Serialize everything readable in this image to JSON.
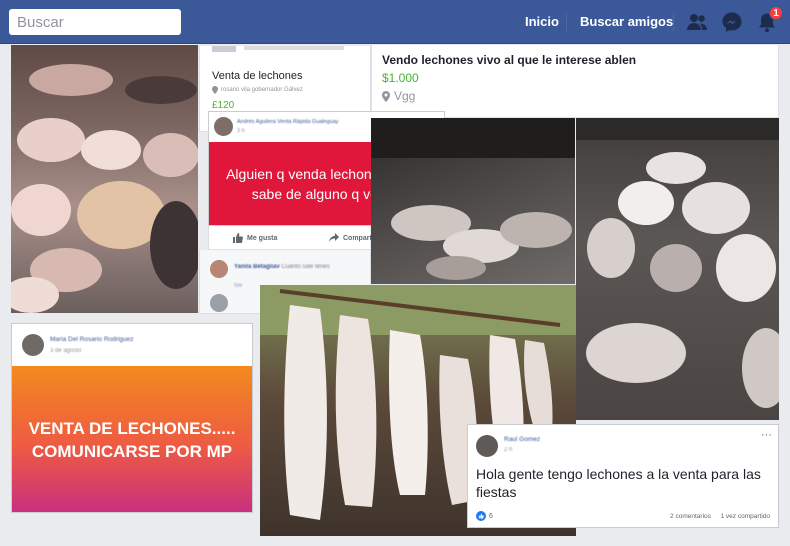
{
  "topbar": {
    "search_placeholder": "Buscar",
    "home_label": "Inicio",
    "find_friends_label": "Buscar amigos",
    "notifications_count": "1",
    "brand_color": "#3b5998"
  },
  "listing": {
    "title": "Venta de lechones",
    "location": "rosario vila gobernador Gálvez",
    "price": "£120"
  },
  "marketplace": {
    "title": "Vendo lechones vivo al que le interese ablen",
    "price": "$1.000",
    "location": "Vgg"
  },
  "post_red": {
    "author": "Andrés Aguilera Venta Rápida Gualeguay",
    "time": "3 h",
    "text": "Alguien q venda lechon entero o sabe de alguno q venda",
    "bg_color": "#e0173b",
    "like_label": "Me gusta",
    "share_label": "Compartir"
  },
  "comments": [
    {
      "author": "Yanila Betagliav",
      "text": "Cuanto sale tenes"
    },
    {
      "author": "",
      "text": "Me"
    }
  ],
  "post_gradient": {
    "author": "Maria Del Rosario Rodriguez",
    "time": "3 de agosto",
    "text": "VENTA DE LECHONES..... COMUNICARSE POR MP"
  },
  "post_bottom": {
    "author": "Raul Gomez",
    "time": "2 h",
    "text": "Hola gente tengo lechones a la venta para las fiestas",
    "reactions": "6",
    "comments": "2 comentarios",
    "shares": "1 vez compartido"
  }
}
